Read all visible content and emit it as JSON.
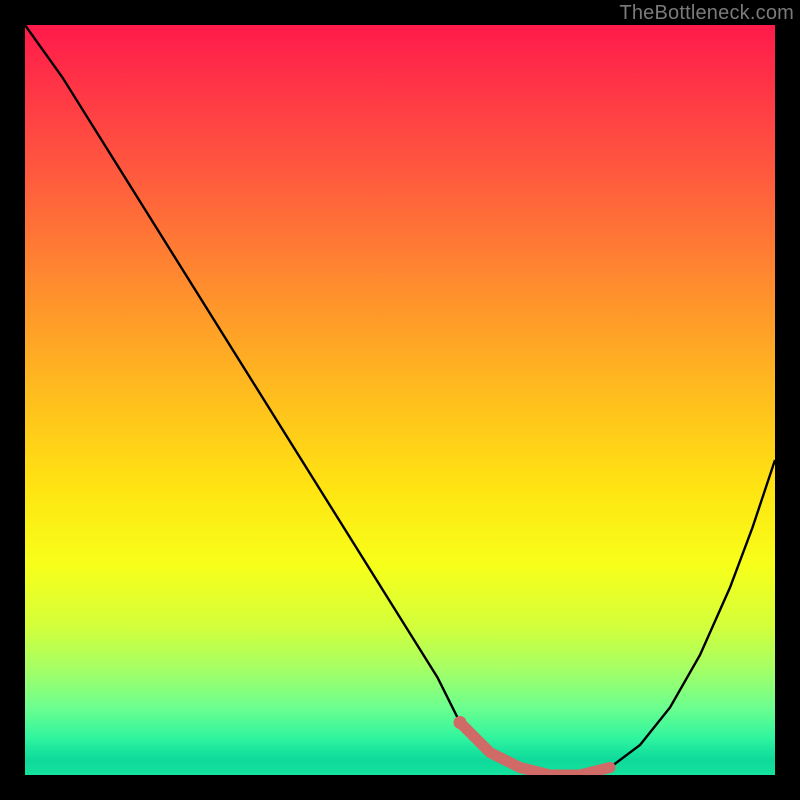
{
  "watermark": "TheBottleneck.com",
  "colors": {
    "frame": "#000000",
    "curve": "#000000",
    "highlight": "#cf6a66"
  },
  "chart_data": {
    "type": "line",
    "title": "",
    "xlabel": "",
    "ylabel": "",
    "xlim": [
      0,
      100
    ],
    "ylim": [
      0,
      100
    ],
    "grid": false,
    "series": [
      {
        "name": "bottleneck-curve",
        "x": [
          0,
          5,
          10,
          15,
          20,
          25,
          30,
          35,
          40,
          45,
          50,
          55,
          58,
          62,
          66,
          70,
          74,
          78,
          82,
          86,
          90,
          94,
          97,
          100
        ],
        "values": [
          100,
          93,
          85,
          77,
          69,
          61,
          53,
          45,
          37,
          29,
          21,
          13,
          7,
          3,
          1,
          0,
          0,
          1,
          4,
          9,
          16,
          25,
          33,
          42
        ]
      }
    ],
    "highlight_segment": {
      "series": "bottleneck-curve",
      "x": [
        58,
        62,
        66,
        70,
        74,
        78
      ],
      "values": [
        7,
        3,
        1,
        0,
        0,
        1
      ],
      "dot": {
        "x": 58,
        "value": 7
      }
    }
  }
}
